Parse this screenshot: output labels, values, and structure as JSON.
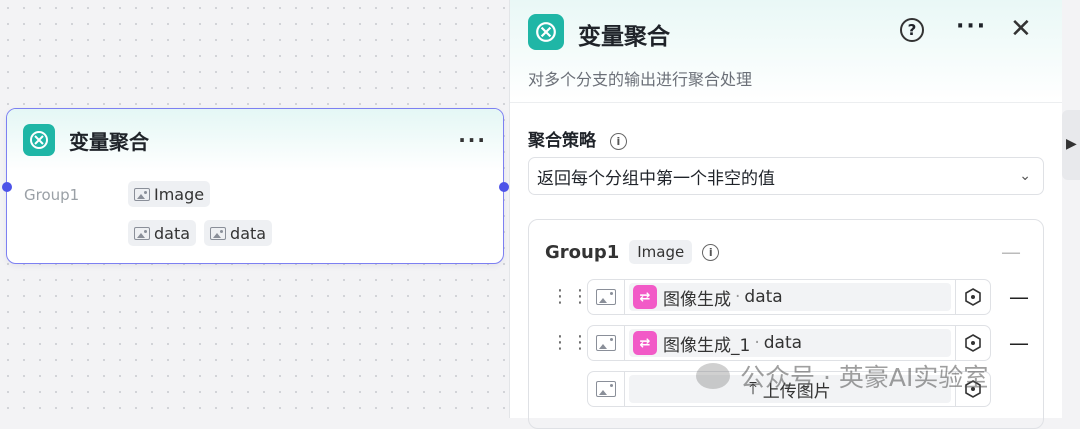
{
  "canvas": {
    "node": {
      "title": "变量聚合",
      "more": "···",
      "group_label": "Group1",
      "chips_row1": [
        "Image"
      ],
      "chips_row2": [
        "data",
        "data"
      ]
    }
  },
  "panel": {
    "title": "变量聚合",
    "help": "?",
    "more": "···",
    "close": "✕",
    "description": "对多个分支的输出进行聚合处理",
    "strategy_title": "聚合策略",
    "strategy_value": "返回每个分组中第一个非空的值",
    "group": {
      "name": "Group1",
      "type": "Image",
      "minus": "—",
      "rows": [
        {
          "source": "图像生成",
          "sep": "·",
          "field": "data"
        },
        {
          "source": "图像生成_1",
          "sep": "·",
          "field": "data"
        }
      ],
      "upload_label": "上传图片"
    }
  },
  "watermark": "公众号 · 英豪AI实验室",
  "colors": {
    "accent": "#4d53e8",
    "node_icon": "#1fb6a6",
    "image_gen": "#f25ac7"
  }
}
